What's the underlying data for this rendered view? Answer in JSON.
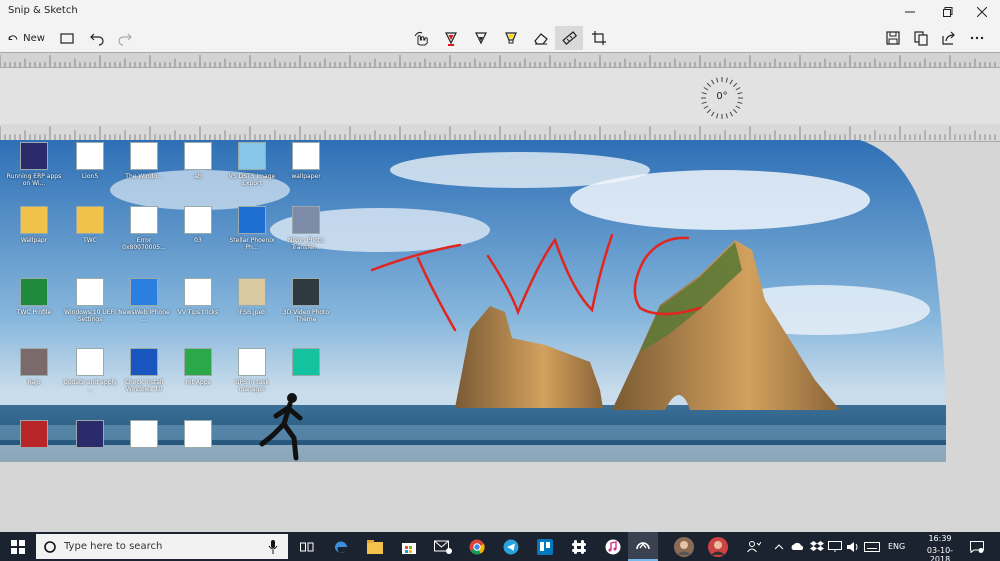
{
  "window": {
    "title": "Snip & Sketch"
  },
  "toolbar": {
    "new_label": "New",
    "tools": [
      {
        "name": "touch-writing",
        "icon": "touch-writing-icon"
      },
      {
        "name": "ballpoint-pen",
        "icon": "ballpoint-pen-icon",
        "color": "#e81123"
      },
      {
        "name": "pencil",
        "icon": "pencil-icon"
      },
      {
        "name": "highlighter",
        "icon": "highlighter-icon",
        "color": "#ffd800"
      },
      {
        "name": "eraser",
        "icon": "eraser-icon"
      },
      {
        "name": "ruler",
        "icon": "ruler-icon",
        "active": true
      },
      {
        "name": "crop",
        "icon": "crop-icon"
      }
    ]
  },
  "ruler": {
    "angle": "0°"
  },
  "annotation": {
    "text": "TWC",
    "color": "#e0261f"
  },
  "desktop": {
    "icons": [
      {
        "label": "Running ERP apps on Wi..."
      },
      {
        "label": "Lion5"
      },
      {
        "label": "The Windo..."
      },
      {
        "label": "ab"
      },
      {
        "label": "VS DSTS Image Export"
      },
      {
        "label": "wallpaper"
      },
      {
        "label": "Wallpapr"
      },
      {
        "label": "TWC"
      },
      {
        "label": "Error 0x80070005..."
      },
      {
        "label": "03"
      },
      {
        "label": "Stellar Phoenix Ph..."
      },
      {
        "label": "Nikon Photo Transfer..."
      },
      {
        "label": "TWC Profile"
      },
      {
        "label": "Windows 10 UEFI Settings"
      },
      {
        "label": "NewsWeb iPhone ..."
      },
      {
        "label": "VV Tips tricks"
      },
      {
        "label": "IFSB.jpeb"
      },
      {
        "label": "3D Video Photo Theme"
      },
      {
        "label": "Rajo"
      },
      {
        "label": "Update and apply ..."
      },
      {
        "label": "Check Install Windows 10"
      },
      {
        "label": "Hit Apps"
      },
      {
        "label": "UPS in task manager"
      },
      {
        "label": ""
      },
      {
        "label": ""
      },
      {
        "label": ""
      },
      {
        "label": ""
      },
      {
        "label": ""
      }
    ]
  },
  "taskbar": {
    "search_placeholder": "Type here to search",
    "lang": "ENG",
    "time": "16:39",
    "date": "03-10-2018"
  },
  "colors": {
    "accent": "#e81123",
    "taskbar": "#1c2330"
  }
}
